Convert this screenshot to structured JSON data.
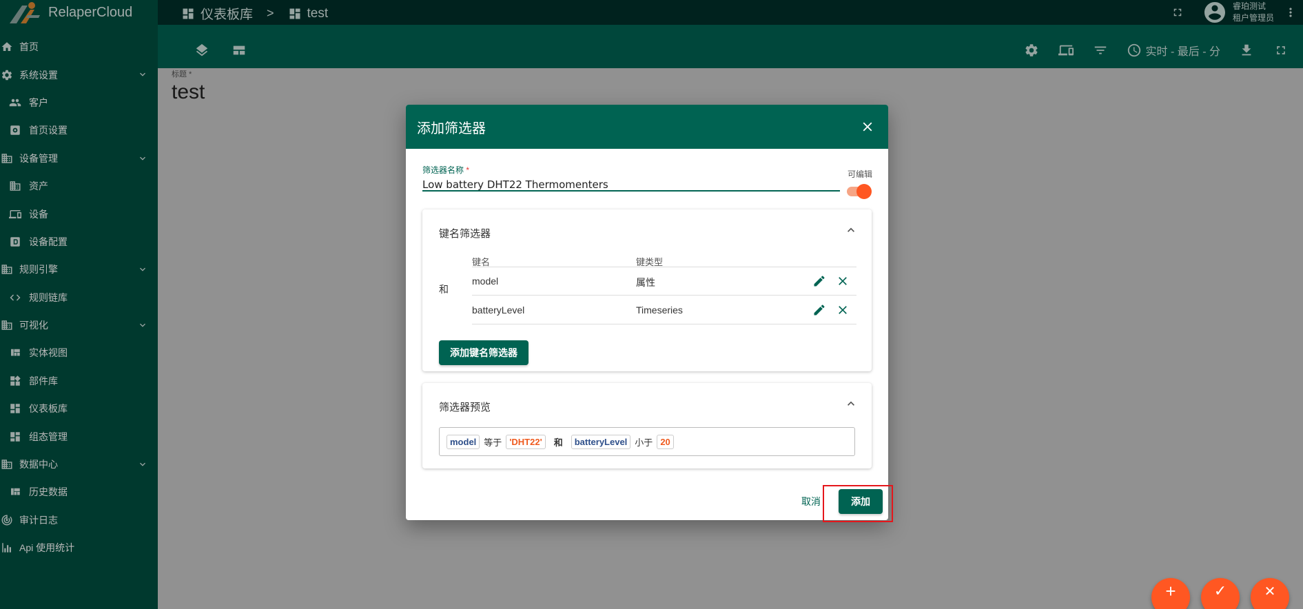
{
  "app": {
    "name": "RelaperCloud"
  },
  "breadcrumb": {
    "parent": "仪表板库",
    "separator": ">",
    "current": "test"
  },
  "user": {
    "name": "睿珀测试",
    "role": "租户管理员"
  },
  "toolbar": {
    "timewindow": "实时 - 最后 - 分"
  },
  "sidebar": {
    "items": [
      {
        "label": "首页",
        "icon": "home-icon",
        "level": "top"
      },
      {
        "label": "系统设置",
        "icon": "gear-icon",
        "level": "top",
        "expanded": true
      },
      {
        "label": "客户",
        "icon": "people-icon",
        "level": "sub"
      },
      {
        "label": "首页设置",
        "icon": "settings-box-icon",
        "level": "sub"
      },
      {
        "label": "设备管理",
        "icon": "building-icon",
        "level": "top",
        "expanded": true
      },
      {
        "label": "资产",
        "icon": "building-icon",
        "level": "sub"
      },
      {
        "label": "设备",
        "icon": "devices-icon",
        "level": "sub"
      },
      {
        "label": "设备配置",
        "icon": "profile-icon",
        "level": "sub"
      },
      {
        "label": "规则引擎",
        "icon": "building-icon",
        "level": "top",
        "expanded": true
      },
      {
        "label": "规则链库",
        "icon": "code-icon",
        "level": "sub"
      },
      {
        "label": "可视化",
        "icon": "building-icon",
        "level": "top",
        "expanded": true
      },
      {
        "label": "实体视图",
        "icon": "view-quilt-icon",
        "level": "sub"
      },
      {
        "label": "部件库",
        "icon": "widgets-icon",
        "level": "sub"
      },
      {
        "label": "仪表板库",
        "icon": "dashboard-icon",
        "level": "sub"
      },
      {
        "label": "组态管理",
        "icon": "dashboard-icon",
        "level": "sub"
      },
      {
        "label": "数据中心",
        "icon": "building-icon",
        "level": "top",
        "expanded": true
      },
      {
        "label": "历史数据",
        "icon": "view-quilt-icon",
        "level": "sub"
      },
      {
        "label": "审计日志",
        "icon": "track-changes-icon",
        "level": "top"
      },
      {
        "label": "Api 使用统计",
        "icon": "bar-chart-icon",
        "level": "top"
      }
    ]
  },
  "content": {
    "title_label": "标题 *",
    "title_value": "test"
  },
  "dialog": {
    "title": "添加筛选器",
    "name_label": "筛选器名称",
    "name_required": "*",
    "name_value": "Low battery DHT22 Thermomenters",
    "editable_label": "可编辑",
    "editable_on": true,
    "key_panel": {
      "title": "键名筛选器",
      "col_key": "键名",
      "col_type": "键类型",
      "operator": "和",
      "rows": [
        {
          "key": "model",
          "type": "属性"
        },
        {
          "key": "batteryLevel",
          "type": "Timeseries"
        }
      ],
      "add_button": "添加键名筛选器"
    },
    "preview_panel": {
      "title": "筛选器预览",
      "tokens": [
        {
          "text": "model",
          "kind": "key"
        },
        {
          "text": "等于",
          "kind": "op"
        },
        {
          "text": "'DHT22'",
          "kind": "val"
        },
        {
          "text": "和",
          "kind": "and"
        },
        {
          "text": "batteryLevel",
          "kind": "key"
        },
        {
          "text": "小于",
          "kind": "op"
        },
        {
          "text": "20",
          "kind": "val"
        }
      ]
    },
    "cancel_label": "取消",
    "add_label": "添加"
  },
  "fabs": {
    "add": "+",
    "apply": "✓",
    "close": "✕"
  },
  "colors": {
    "primary": "#006352",
    "sidebar": "#005041",
    "accent": "#ff5722",
    "highlight": "#e5161b"
  }
}
